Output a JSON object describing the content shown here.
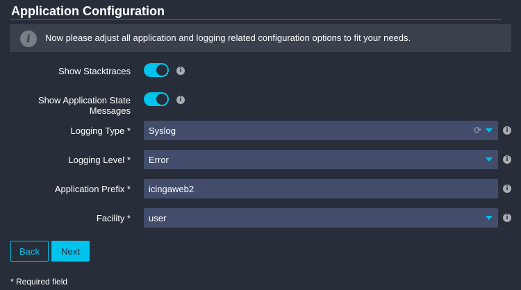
{
  "page": {
    "title": "Application Configuration",
    "info_text": "Now please adjust all application and logging related configuration options to fit your needs.",
    "info_icon": "i"
  },
  "form": {
    "show_stacktraces": {
      "label": "Show Stacktraces",
      "enabled": true
    },
    "show_state_messages": {
      "label_line1": "Show Application State",
      "label_line2": "Messages",
      "enabled": true
    },
    "logging_type": {
      "label": "Logging Type *",
      "value": "Syslog"
    },
    "logging_level": {
      "label": "Logging Level *",
      "value": "Error"
    },
    "application_prefix": {
      "label": "Application Prefix *",
      "value": "icingaweb2"
    },
    "facility": {
      "label": "Facility *",
      "value": "user"
    },
    "hint_glyph": "i"
  },
  "actions": {
    "back_label": "Back",
    "next_label": "Next"
  },
  "footer": {
    "required_note": "* Required field"
  },
  "colors": {
    "background": "#282e39",
    "accent": "#00c3ed",
    "field_bg": "#434d6b",
    "info_box_bg": "#3a414d"
  }
}
